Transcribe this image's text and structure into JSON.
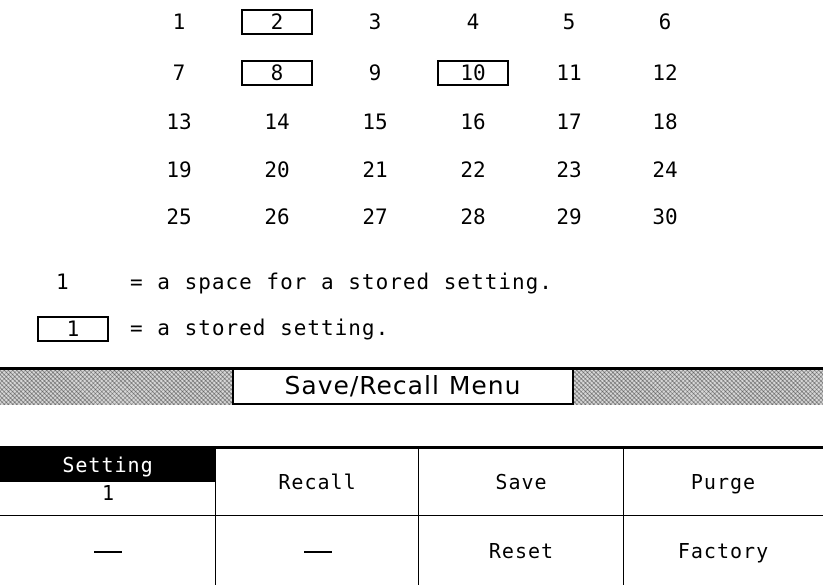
{
  "register_grid": {
    "cells": [
      {
        "label": "1",
        "stored": false
      },
      {
        "label": "2",
        "stored": true
      },
      {
        "label": "3",
        "stored": false
      },
      {
        "label": "4",
        "stored": false
      },
      {
        "label": "5",
        "stored": false
      },
      {
        "label": "6",
        "stored": false
      },
      {
        "label": "7",
        "stored": false
      },
      {
        "label": "8",
        "stored": true
      },
      {
        "label": "9",
        "stored": false
      },
      {
        "label": "10",
        "stored": true
      },
      {
        "label": "11",
        "stored": false
      },
      {
        "label": "12",
        "stored": false
      },
      {
        "label": "13",
        "stored": false
      },
      {
        "label": "14",
        "stored": false
      },
      {
        "label": "15",
        "stored": false
      },
      {
        "label": "16",
        "stored": false
      },
      {
        "label": "17",
        "stored": false
      },
      {
        "label": "18",
        "stored": false
      },
      {
        "label": "19",
        "stored": false
      },
      {
        "label": "20",
        "stored": false
      },
      {
        "label": "21",
        "stored": false
      },
      {
        "label": "22",
        "stored": false
      },
      {
        "label": "23",
        "stored": false
      },
      {
        "label": "24",
        "stored": false
      },
      {
        "label": "25",
        "stored": false
      },
      {
        "label": "26",
        "stored": false
      },
      {
        "label": "27",
        "stored": false
      },
      {
        "label": "28",
        "stored": false
      },
      {
        "label": "29",
        "stored": false
      },
      {
        "label": "30",
        "stored": false
      }
    ]
  },
  "legend": {
    "space_symbol": "1",
    "space_text": "= a space for a stored setting.",
    "stored_symbol": "1",
    "stored_text": "= a stored setting."
  },
  "menu": {
    "title": "Save/Recall Menu"
  },
  "softkeys": {
    "setting_label": "Setting",
    "setting_value": "1",
    "recall": "Recall",
    "save": "Save",
    "purge": "Purge",
    "reset": "Reset",
    "factory": "Factory",
    "blank_key_1_icon": "dash",
    "blank_key_2_icon": "dash"
  }
}
